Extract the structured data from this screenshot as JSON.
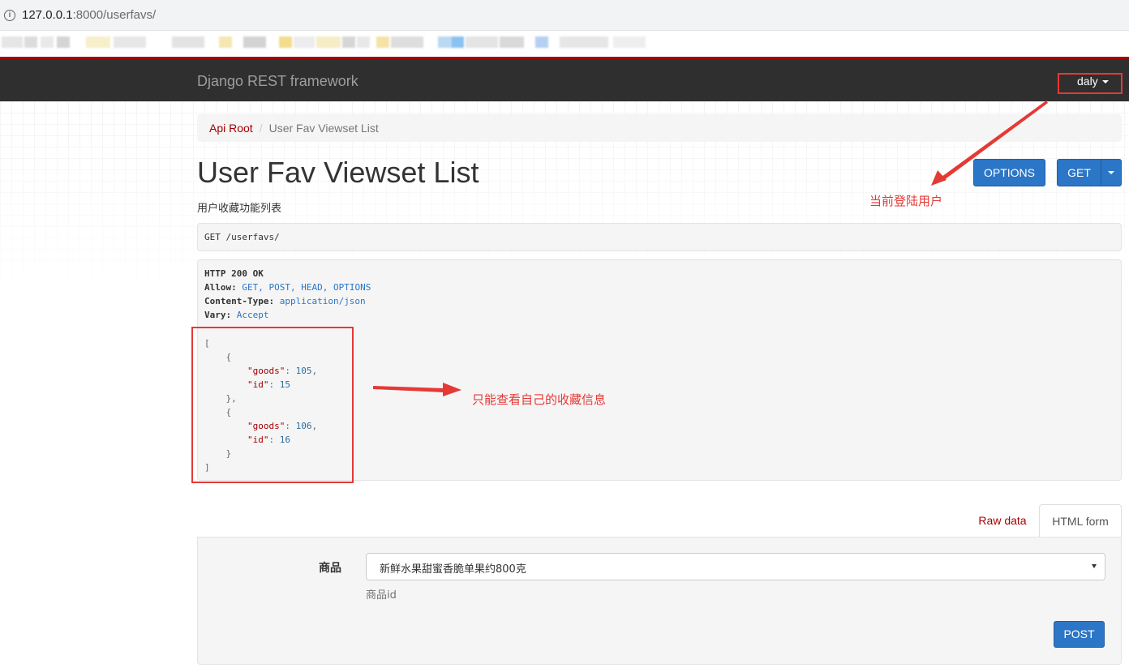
{
  "browser": {
    "url_host": "127.0.0.1",
    "url_port": ":8000",
    "url_path": "/userfavs/"
  },
  "navbar": {
    "brand": "Django REST framework",
    "user": "daly"
  },
  "breadcrumb": {
    "root": "Api Root",
    "current": "User Fav Viewset List"
  },
  "page": {
    "title": "User Fav Viewset List",
    "description": "用户收藏功能列表"
  },
  "actions": {
    "options_label": "OPTIONS",
    "get_label": "GET"
  },
  "request": {
    "line": "GET /userfavs/"
  },
  "response": {
    "status": "HTTP 200 OK",
    "headers": [
      {
        "key": "Allow:",
        "value": "GET, POST, HEAD, OPTIONS"
      },
      {
        "key": "Content-Type:",
        "value": "application/json"
      },
      {
        "key": "Vary:",
        "value": "Accept"
      }
    ],
    "items": [
      {
        "goods": "105",
        "id": "15"
      },
      {
        "goods": "106",
        "id": "16"
      }
    ]
  },
  "annotations": {
    "current_user": "当前登陆用户",
    "own_favs_only": "只能查看自己的收藏信息",
    "color": "#e53935"
  },
  "tabs": {
    "raw": "Raw data",
    "html": "HTML form"
  },
  "form": {
    "goods_label": "商品",
    "goods_value": "新鲜水果甜蜜香脆单果约800克",
    "goods_help": "商品id",
    "post_label": "POST"
  },
  "colors": {
    "navbar_bg": "#2f2f2f",
    "brand_accent": "#a30000",
    "primary": "#2c76c7"
  }
}
